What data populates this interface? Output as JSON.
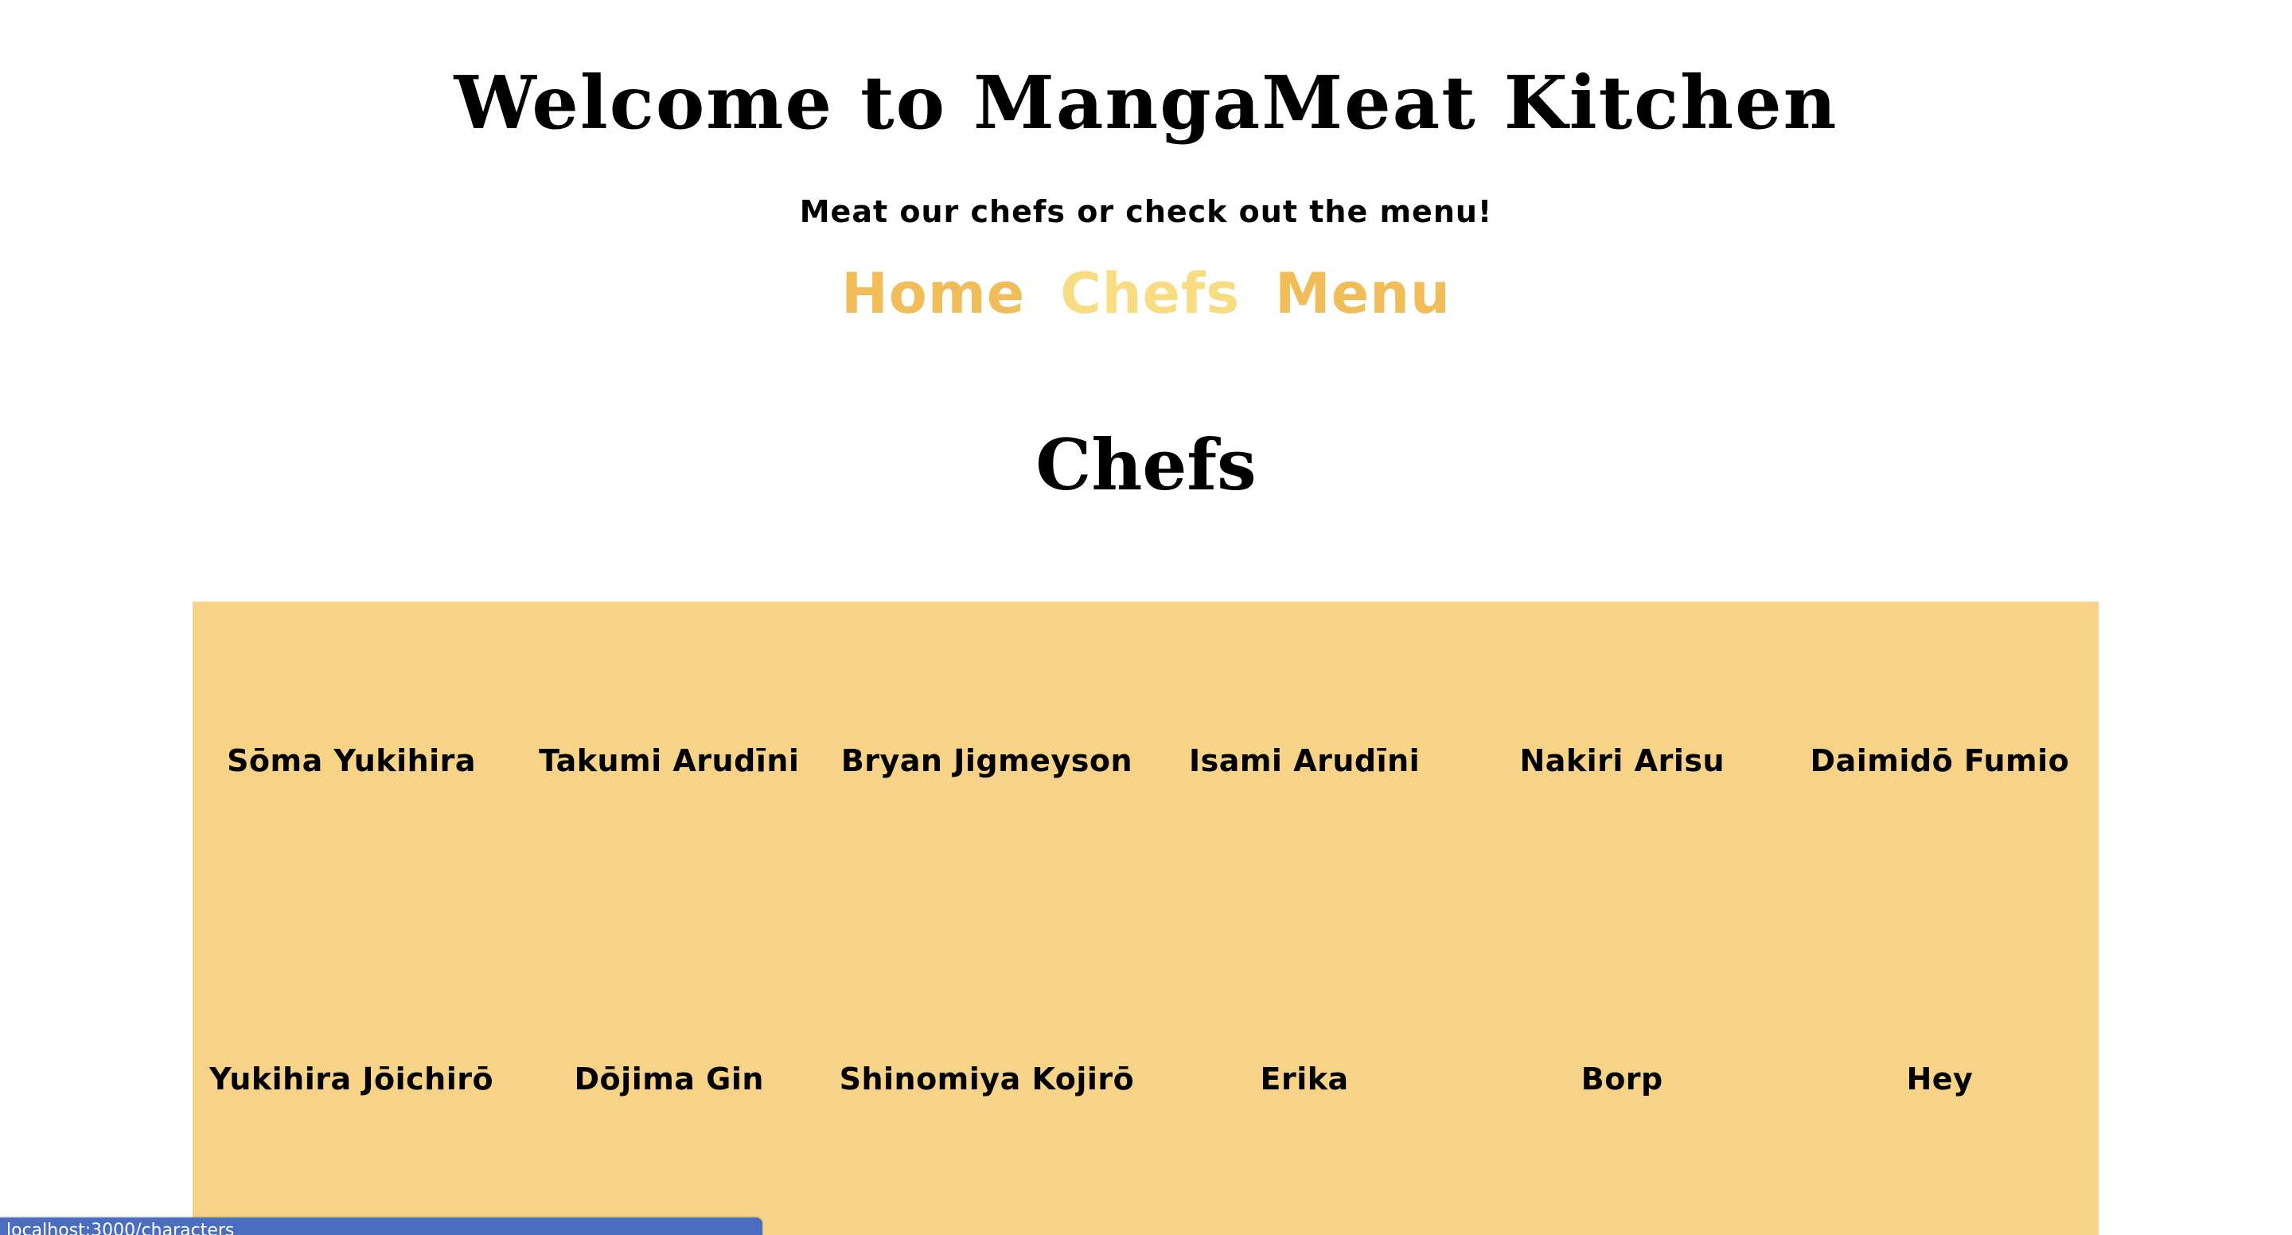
{
  "header": {
    "title": "Welcome to MangaMeat Kitchen",
    "tagline": "Meat our chefs or check out the menu!"
  },
  "nav": {
    "items": [
      {
        "label": "Home",
        "active": false
      },
      {
        "label": "Chefs",
        "active": true
      },
      {
        "label": "Menu",
        "active": false
      }
    ]
  },
  "main": {
    "heading": "Chefs",
    "chefs": [
      "Sōma Yukihira",
      "Takumi Arudīni",
      "Bryan Jigmeyson",
      "Isami Arudīni",
      "Nakiri Arisu",
      "Daimidō Fumio",
      "Yukihira Jōichirō",
      "Dōjima Gin",
      "Shinomiya Kojirō",
      "Erika",
      "Borp",
      "Hey"
    ]
  },
  "status_bar": {
    "url": "localhost:3000/characters"
  },
  "colors": {
    "nav_link": "#f0bd58",
    "nav_active": "#f8dc82",
    "panel_background": "#f7d388",
    "status_bar": "#4a6dbf"
  }
}
